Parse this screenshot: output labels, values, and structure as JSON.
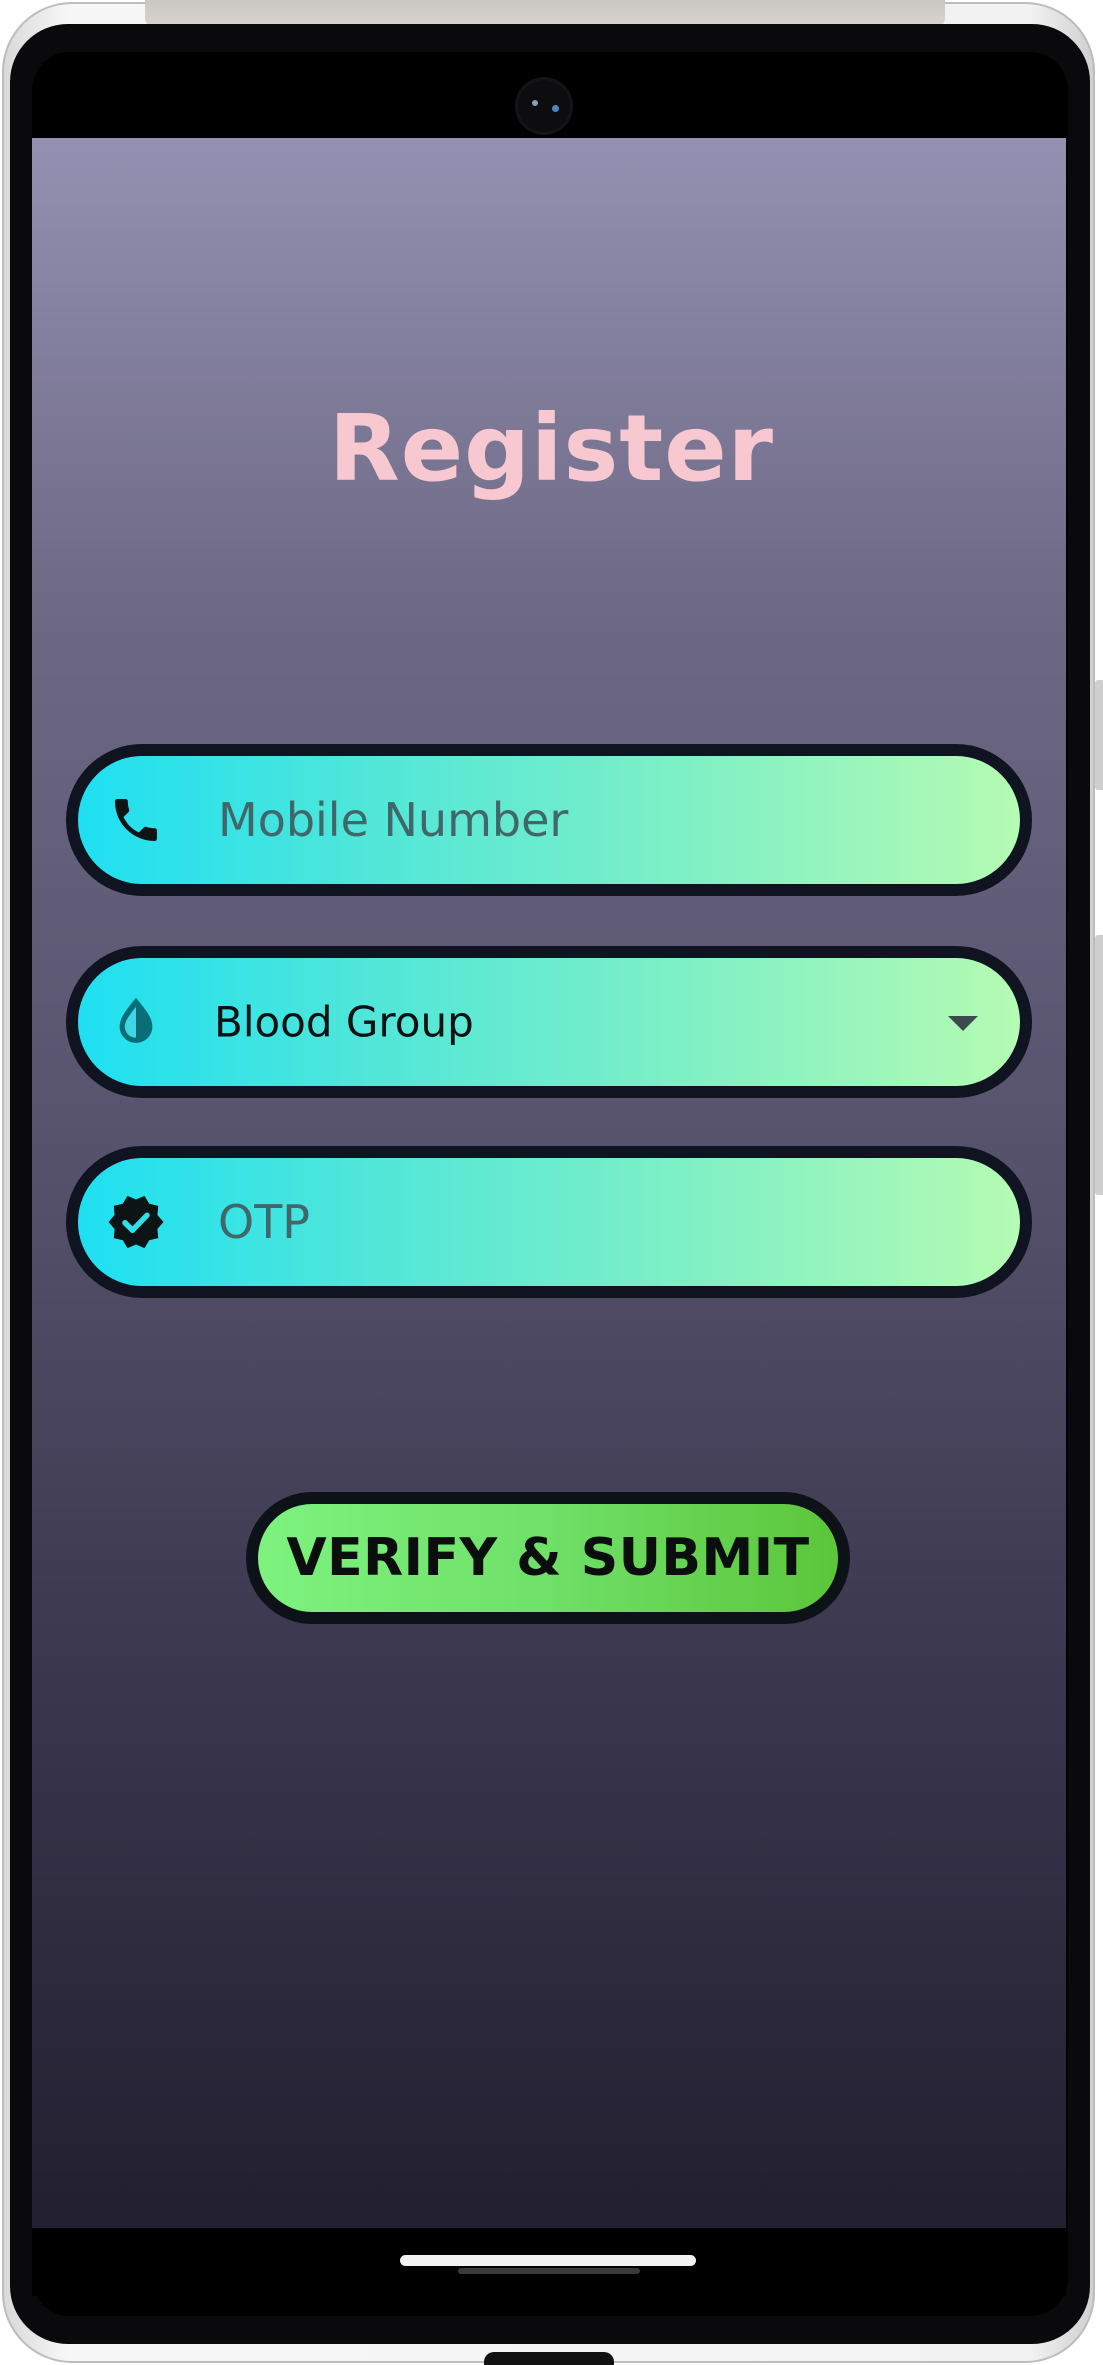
{
  "screen": {
    "title": "Register"
  },
  "form": {
    "mobile": {
      "placeholder": "Mobile Number",
      "icon": "phone-icon"
    },
    "blood_group": {
      "selected": "Blood Group",
      "icon": "water-drop-icon",
      "arrow_icon": "dropdown-arrow-icon"
    },
    "otp": {
      "placeholder": "OTP",
      "icon": "verified-badge-icon"
    }
  },
  "actions": {
    "submit_label": "VERIFY & SUBMIT"
  },
  "colors": {
    "title": "#f7c8cf",
    "field_gradient_start": "#1ee0f2",
    "field_gradient_end": "#b5fbb3",
    "button_gradient_start": "#7ef27f",
    "button_gradient_end": "#5cc53a",
    "background_top": "#9390b1",
    "background_bottom": "#221f30"
  }
}
